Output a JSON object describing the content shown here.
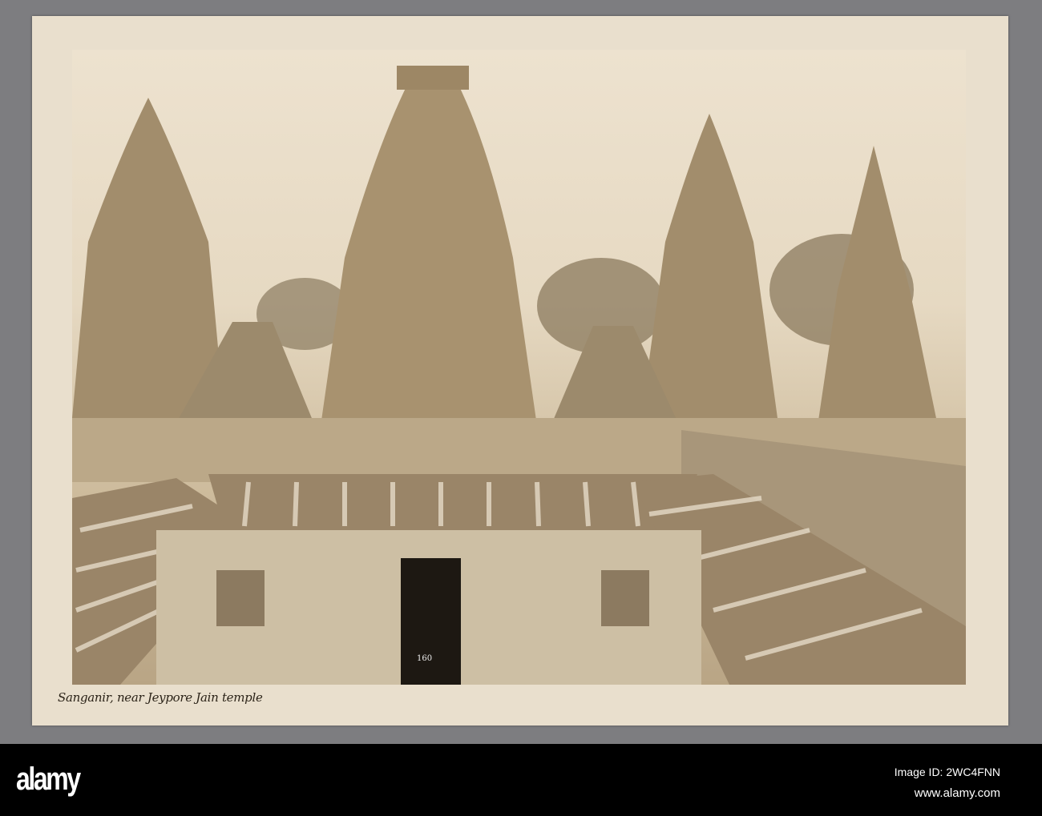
{
  "photo": {
    "caption": "Sanganir, near Jeypore Jain temple",
    "door_number": "160"
  },
  "watermark": {
    "logo": "alamy",
    "image_id": "Image ID: 2WC4FNN",
    "site": "www.alamy.com"
  }
}
